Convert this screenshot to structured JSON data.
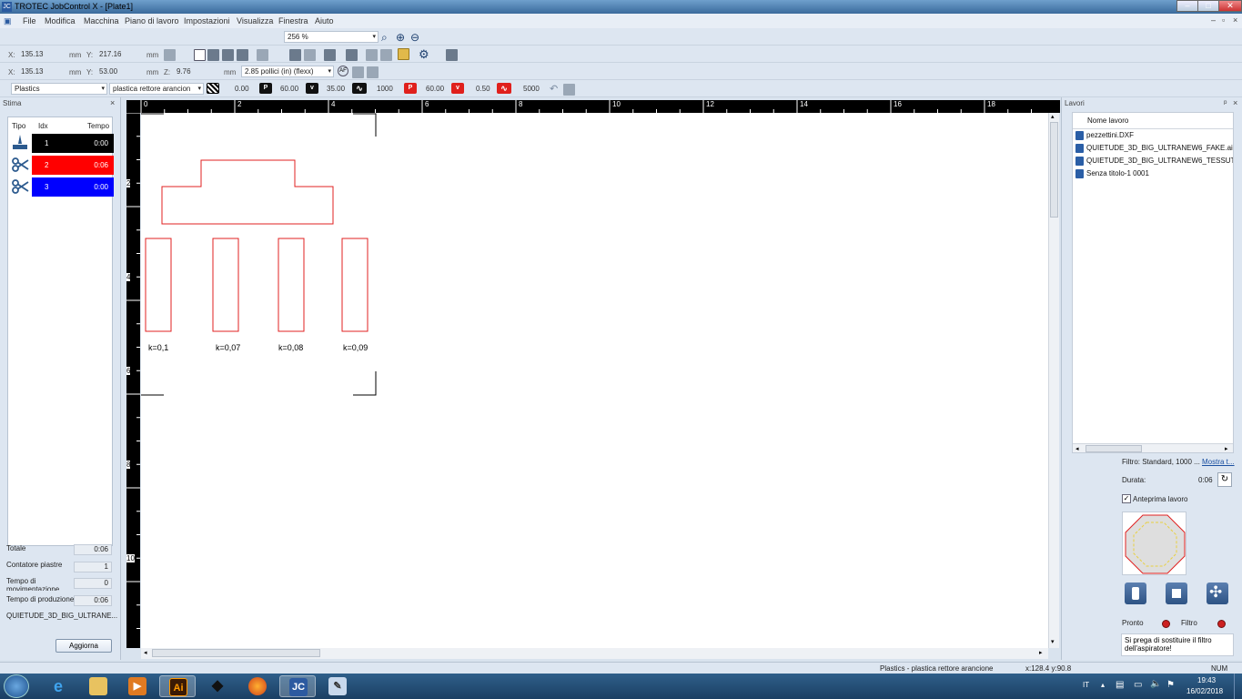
{
  "window": {
    "title": "TROTEC JobControl X - [Plate1]",
    "app_icon": "JC"
  },
  "menu": [
    "File",
    "Modifica",
    "Macchina",
    "Piano di lavoro",
    "Impostazioni",
    "Visualizza",
    "Finestra",
    "Aiuto"
  ],
  "toolbar1": {
    "zoom": "256 %"
  },
  "toolbar2": {
    "x_label": "X:",
    "x_value": "135.13",
    "x_unit": "mm",
    "y_label": "Y:",
    "y_value": "217.16",
    "y_unit": "mm"
  },
  "toolbar3": {
    "x_label": "X:",
    "x_value": "135.13",
    "x_unit": "mm",
    "y_label": "Y:",
    "y_value": "53.00",
    "y_unit": "mm",
    "z_label": "Z:",
    "z_value": "9.76",
    "z_unit": "mm",
    "lens": "2.85 pollici (in) (flexx)"
  },
  "toolbar4": {
    "material_group": "Plastics",
    "material": "plastica rettore arancion",
    "hatch_value": "0.00",
    "p_label": "P",
    "p_value": "60.00",
    "v_label": "v",
    "v_value": "35.00",
    "freq_value": "1000",
    "p2_label": "P",
    "p2_value": "60.00",
    "v2_label": "v",
    "v2_value": "0.50",
    "freq2_value": "5000"
  },
  "stima": {
    "title": "Stima",
    "close": "×",
    "headers": {
      "tipo": "Tipo",
      "idx": "Idx",
      "tempo": "Tempo"
    },
    "rows": [
      {
        "idx": "1",
        "tempo": "0:00",
        "color": "#000000",
        "icon": "engrave-icon"
      },
      {
        "idx": "2",
        "tempo": "0:06",
        "color": "#ff0000",
        "icon": "cut-icon"
      },
      {
        "idx": "3",
        "tempo": "0:00",
        "color": "#0000ff",
        "icon": "cut-icon"
      }
    ],
    "totale_label": "Totale",
    "totale_value": "0:06",
    "contatore_label": "Contatore piastre",
    "contatore_value": "1",
    "movimentazione_label": "Tempo di movimentazione",
    "movimentazione_value": "0",
    "produzione_label": "Tempo di produzione",
    "produzione_value": "0:06",
    "job_name": "QUIETUDE_3D_BIG_ULTRANE...",
    "aggiorna_label": "Aggiorna"
  },
  "ruler": {
    "top": [
      "0",
      "2",
      "4",
      "6",
      "8",
      "10",
      "12",
      "14",
      "16",
      "18"
    ],
    "left": [
      "2",
      "4",
      "6",
      "8",
      "10"
    ]
  },
  "canvas": {
    "k_labels": [
      "k=0,1",
      "k=0,07",
      "k=0,08",
      "k=0,09"
    ],
    "shape_color": "#e02020"
  },
  "lavori": {
    "title": "Lavori",
    "pin": "ᵖ",
    "close": "×",
    "column_header": "Nome lavoro",
    "jobs": [
      "pezzettini.DXF",
      "QUIETUDE_3D_BIG_ULTRANEW6_FAKE.ai",
      "QUIETUDE_3D_BIG_ULTRANEW6_TESSUTO",
      "Senza titolo-1 0001"
    ],
    "filter_text": "Filtro: Standard, 1000 ...",
    "show_link": "Mostra t...",
    "durata_label": "Durata:",
    "durata_value": "0:06",
    "preview_label": "Anteprima lavoro",
    "pronto_label": "Pronto",
    "filtro_label": "Filtro",
    "message": "Si prega di sostituire il filtro dell'aspiratore!"
  },
  "statusbar": {
    "material": "Plastics - plastica rettore arancione",
    "coords": "x:128.4   y:90.8",
    "num": "NUM"
  },
  "taskbar": {
    "lang": "IT",
    "time": "19:43",
    "date": "16/02/2018",
    "apps": [
      "start-icon",
      "ie-icon",
      "explorer-icon",
      "media-icon",
      "illustrator-icon",
      "inkscape-icon",
      "firefox-icon",
      "jobcontrol-icon",
      "paint-icon"
    ],
    "ai_label": "Ai",
    "jc_label": "JC"
  }
}
